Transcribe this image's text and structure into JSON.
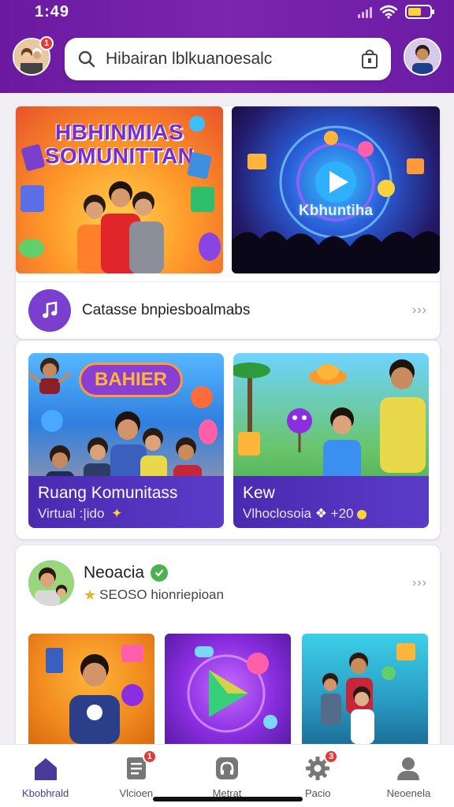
{
  "status_bar": {
    "time": "1:49",
    "battery_level": 0.6
  },
  "header": {
    "search_placeholder": "Hibairan lblkuanoesalc",
    "left_avatar_badge": "1",
    "icons": {
      "search": "search-icon",
      "bag": "shopping-bag-icon"
    }
  },
  "featured": {
    "banner1_title": "HBHINMIAS SOMUNITTAN",
    "banner2_title": "Kbhuntiha",
    "row_text": "Catasse bnpiesboalmabs",
    "row_chevrons": "›››",
    "row_icon": "music-note-icon"
  },
  "community": {
    "sticker_text": "BAHIER",
    "tile1": {
      "title": "Ruang Komunitass",
      "subtitle": "Virtual :|іdo"
    },
    "tile2": {
      "title": "Kew",
      "subtitle": "Vlhoclosoia",
      "count": "+20"
    }
  },
  "profile": {
    "name": "Neoacia",
    "subtitle": "SЕOSO hionriepioan",
    "chevrons": "›››"
  },
  "bottom_nav": [
    {
      "label": "Kbobhrald",
      "icon": "home-icon",
      "badge": ""
    },
    {
      "label": "Vlcioen",
      "icon": "document-icon",
      "badge": "1"
    },
    {
      "label": "Metrat",
      "icon": "headphones-icon",
      "badge": ""
    },
    {
      "label": "Pacio",
      "icon": "gear-icon",
      "badge": "3"
    },
    {
      "label": "Neoenela",
      "icon": "user-icon",
      "badge": ""
    }
  ],
  "colors": {
    "header": "#6a1aa0",
    "accent": "#5a3bc8",
    "badge": "#e53935"
  }
}
